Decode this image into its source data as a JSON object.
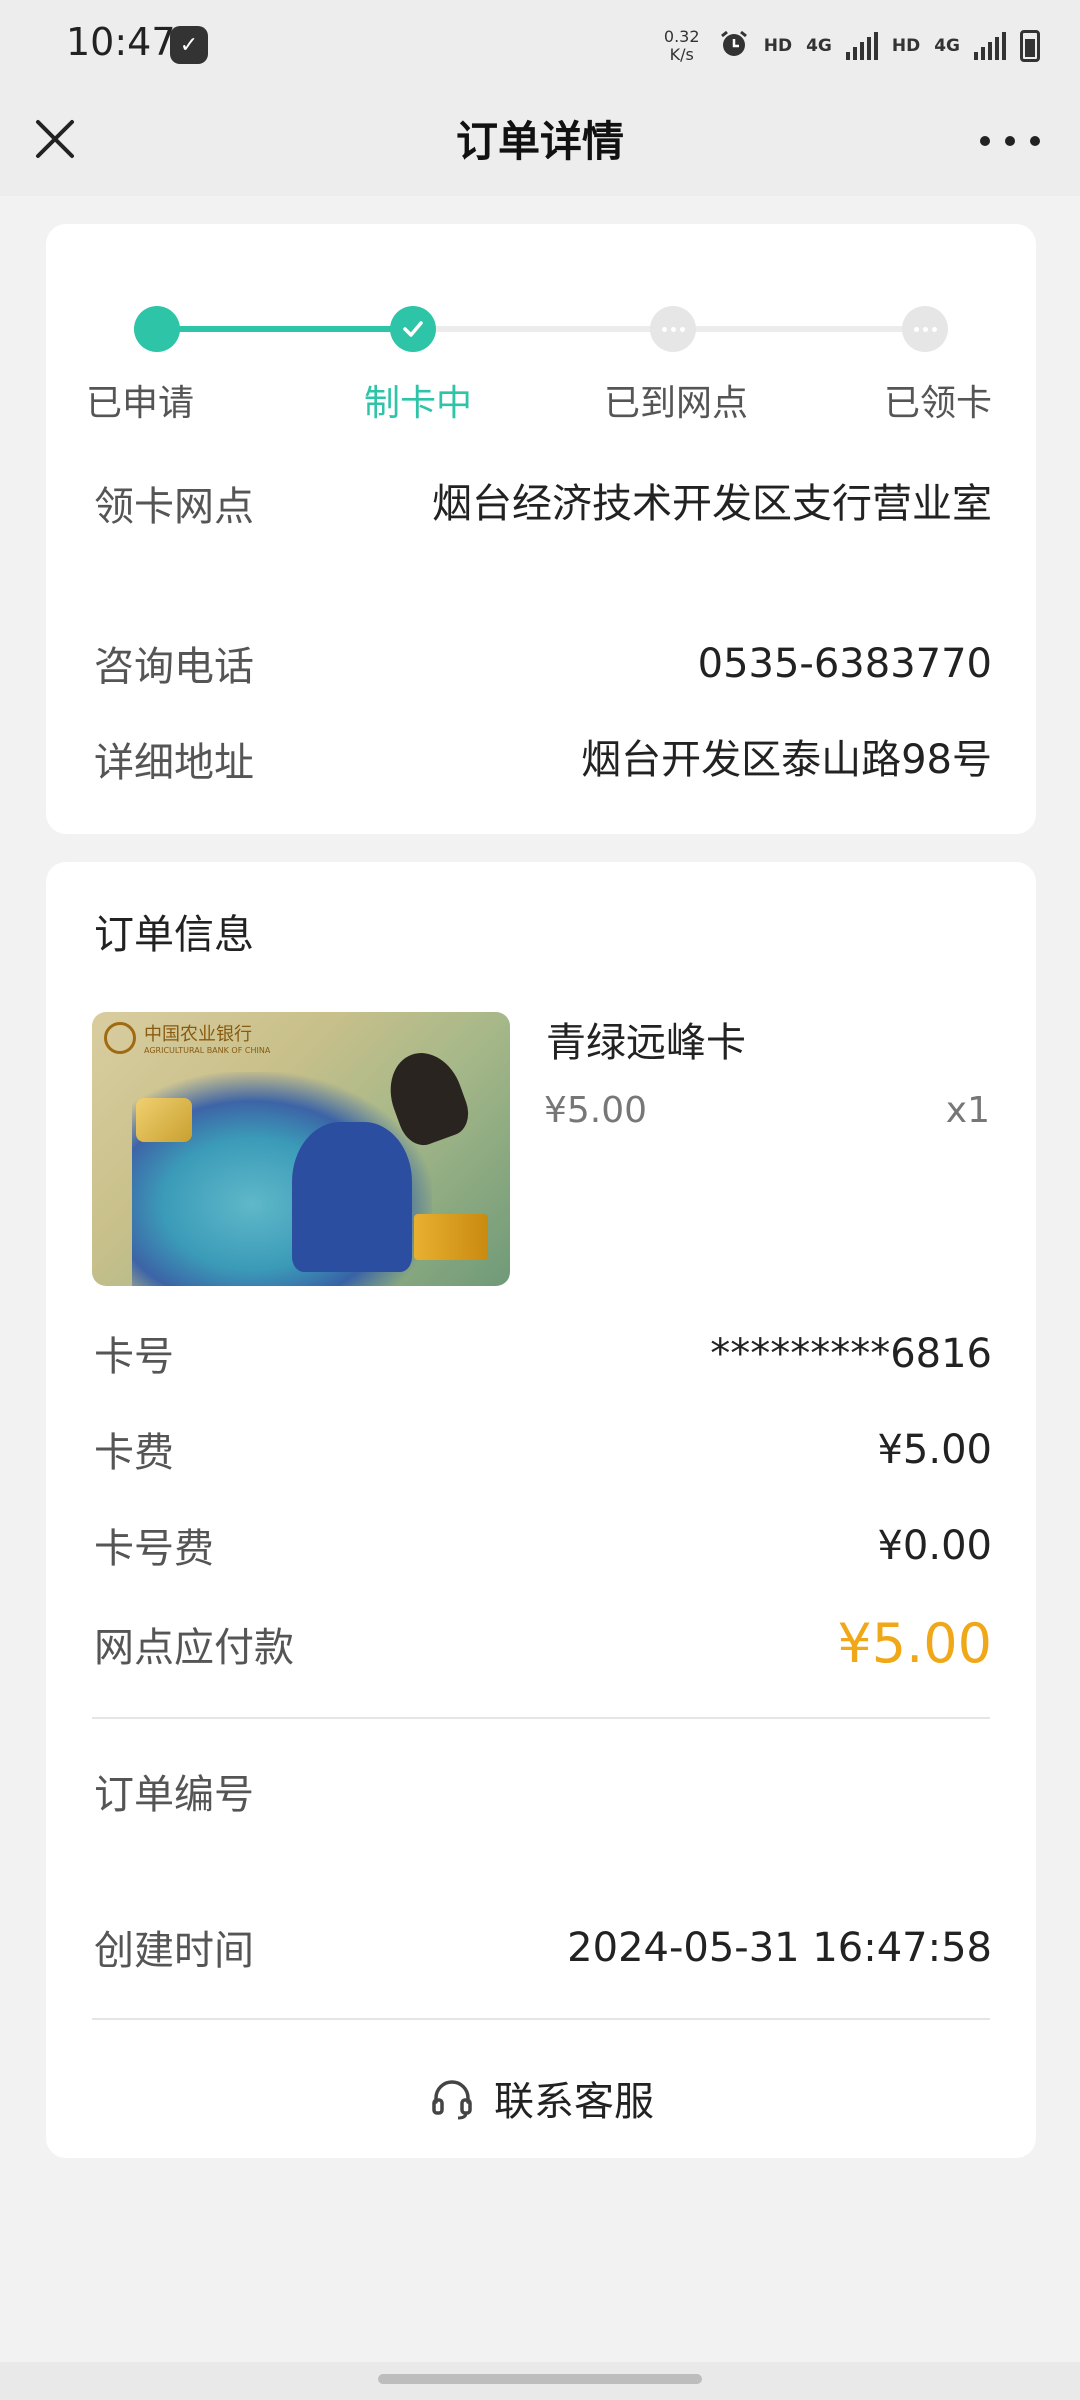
{
  "status_bar": {
    "time": "10:47",
    "speed": "0.32\nK/s",
    "hd1": "HD",
    "net1": "4G",
    "hd2": "HD",
    "net2": "4G",
    "icons": [
      "notification-icon",
      "alarm-icon",
      "signal-icon",
      "battery-icon"
    ]
  },
  "header": {
    "title": "订单详情",
    "close_icon": "close-icon",
    "more_icon": "more-icon"
  },
  "progress": {
    "steps": [
      {
        "label": "已申请",
        "state": "done"
      },
      {
        "label": "制卡中",
        "state": "current"
      },
      {
        "label": "已到网点",
        "state": "pending"
      },
      {
        "label": "已领卡",
        "state": "pending"
      }
    ],
    "accent": "#2ec4a8"
  },
  "branch_info": {
    "branch_label": "领卡网点",
    "branch_value": "烟台经济技术开发区支行营业室",
    "phone_label": "咨询电话",
    "phone_value": "0535-6383770",
    "address_label": "详细地址",
    "address_value": "烟台开发区泰山路98号"
  },
  "order_info": {
    "section_title": "订单信息",
    "product": {
      "name": "青绿远峰卡",
      "price": "¥5.00",
      "quantity": "x1",
      "bank_name": "中国农业银行",
      "bank_name_en": "AGRICULTURAL BANK OF CHINA"
    },
    "card_no_label": "卡号",
    "card_no_value": "*********6816",
    "card_fee_label": "卡费",
    "card_fee_value": "¥5.00",
    "number_fee_label": "卡号费",
    "number_fee_value": "¥0.00",
    "pay_label": "网点应付款",
    "pay_value": "¥5.00",
    "order_no_label": "订单编号",
    "order_no_value": "",
    "created_label": "创建时间",
    "created_value": "2024-05-31 16:47:58",
    "price_color": "#f0a818"
  },
  "service": {
    "label": "联系客服",
    "icon": "headset-icon"
  }
}
